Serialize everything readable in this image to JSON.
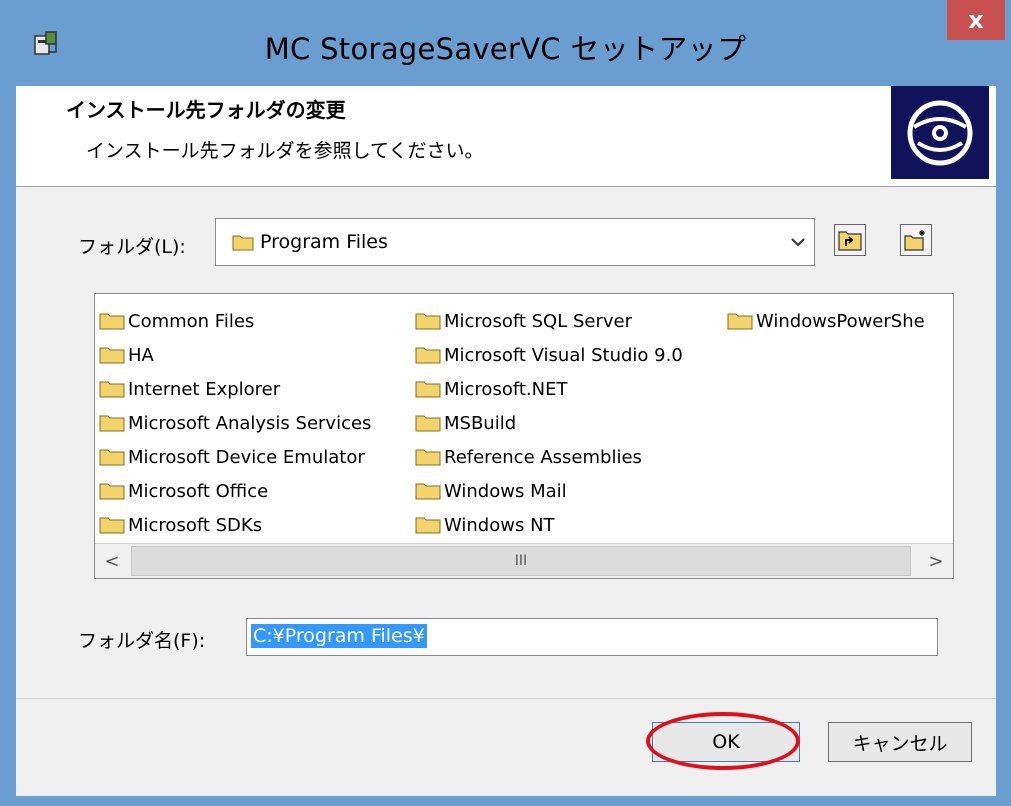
{
  "window": {
    "title": "MC StorageSaverVC セットアップ",
    "close_label": "x"
  },
  "banner": {
    "title": "インストール先フォルダの変更",
    "subtitle": "インストール先フォルダを参照してください。"
  },
  "folder_combo": {
    "label": "フォルダ(L):",
    "value": "Program Files"
  },
  "folder_list": {
    "columns": [
      [
        "Common Files",
        "HA",
        "Internet Explorer",
        "Microsoft Analysis Services",
        "Microsoft Device Emulator",
        "Microsoft Office",
        "Microsoft SDKs"
      ],
      [
        "Microsoft SQL Server",
        "Microsoft Visual Studio 9.0",
        "Microsoft.NET",
        "MSBuild",
        "Reference Assemblies",
        "Windows Mail",
        "Windows NT"
      ],
      [
        "WindowsPowerShe"
      ]
    ]
  },
  "scrollbar": {
    "left_arrow": "<",
    "right_arrow": ">",
    "grip": "III"
  },
  "folder_name": {
    "label": "フォルダ名(F):",
    "value": "C:¥Program Files¥"
  },
  "buttons": {
    "ok": "OK",
    "cancel": "キャンセル"
  },
  "colors": {
    "title_bar": "#6a9dd0",
    "close_button": "#c75050",
    "selection": "#3399ff",
    "annotation": "#e0101a"
  }
}
